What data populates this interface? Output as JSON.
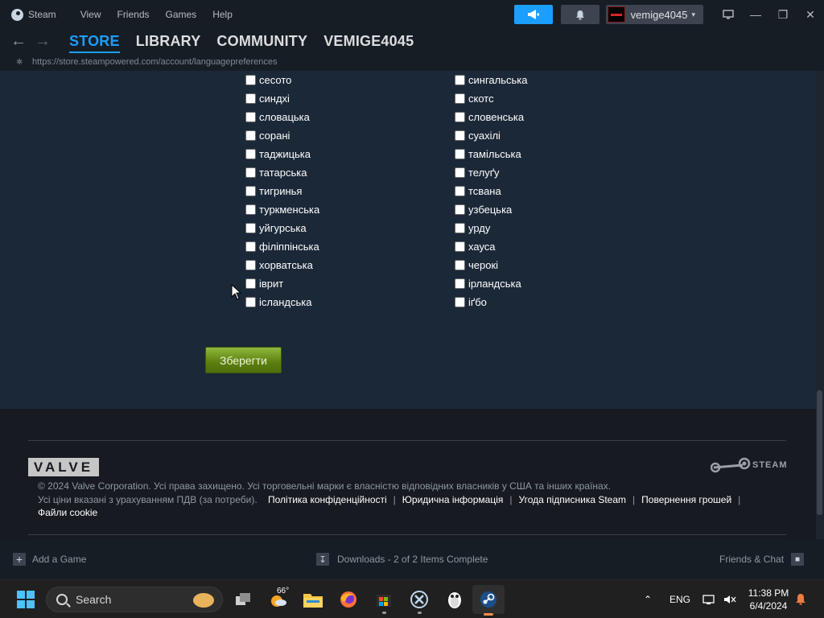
{
  "window": {
    "app_name": "Steam",
    "menu": [
      "View",
      "Friends",
      "Games",
      "Help"
    ],
    "account_name": "vemige4045",
    "controls": {
      "minimize": "—",
      "maximize": "❐",
      "close": "✕"
    }
  },
  "nav": {
    "tabs": [
      "STORE",
      "LIBRARY",
      "COMMUNITY",
      "VEMIGE4045"
    ],
    "active_tab": "STORE",
    "url": "https://store.steampowered.com/account/languagepreferences"
  },
  "languages": {
    "column_1": [
      "сесото",
      "синдхі",
      "словацька",
      "сорані",
      "таджицька",
      "татарська",
      "тигринья",
      "туркменська",
      "уйгурська",
      "філіппінська",
      "хорватська",
      "іврит",
      "ісландська"
    ],
    "column_2": [
      "сингальська",
      "скотс",
      "словенська",
      "суахілі",
      "тамільська",
      "телуґу",
      "тсвана",
      "узбецька",
      "урду",
      "хауса",
      "черокі",
      "ірландська",
      "іґбо"
    ],
    "save_label": "Зберегти"
  },
  "footer": {
    "valve_logo": "VALVE",
    "steam_logo": "STEAM",
    "copyright": "© 2024 Valve Corporation. Усі права захищено. Усі торговельні марки є власністю відповідних власників у США та інших країнах.",
    "vat_note": "Усі ціни вказані з урахуванням ПДВ (за потреби).",
    "links": [
      "Політика конфіденційності",
      "Юридична інформація",
      "Угода підписника Steam",
      "Повернення грошей",
      "Файли cookie"
    ]
  },
  "bottombar": {
    "add_game": "Add a Game",
    "downloads": "Downloads - 2 of 2 Items Complete",
    "friends_chat": "Friends & Chat"
  },
  "taskbar": {
    "search_label": "Search",
    "weather_temp": "66°",
    "language": "ENG",
    "time": "11:38 PM",
    "date": "6/4/2024"
  },
  "colors": {
    "accent": "#1a9fff",
    "save_button": "#6c9018",
    "background": "#1b2838"
  }
}
